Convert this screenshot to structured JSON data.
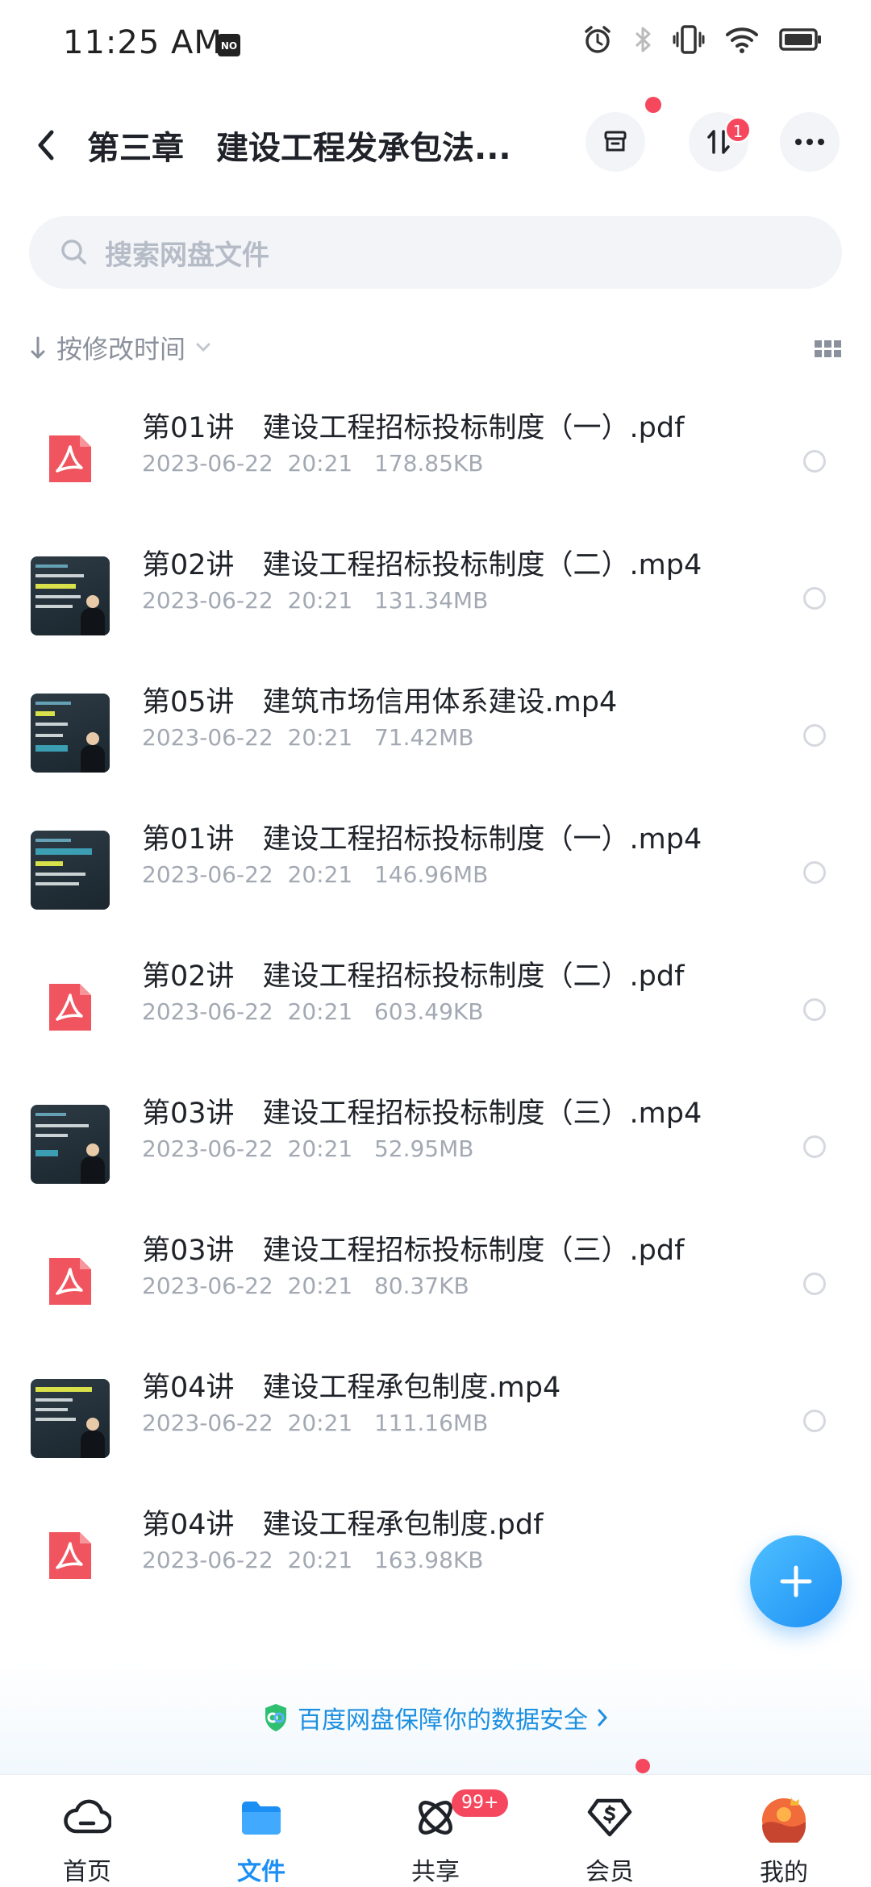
{
  "status_bar": {
    "time": "11:25 AM",
    "nfc_label": "NO"
  },
  "header": {
    "title": "第三章　建设工程发承包法...",
    "transfer_badge": "1"
  },
  "search": {
    "placeholder": "搜索网盘文件"
  },
  "sort": {
    "label": "按修改时间"
  },
  "files": [
    {
      "name": "第01讲　建设工程招标投标制度（一）.pdf",
      "date": "2023-06-22",
      "time": "20:21",
      "size": "178.85KB",
      "type": "pdf"
    },
    {
      "name": "第02讲　建设工程招标投标制度（二）.mp4",
      "date": "2023-06-22",
      "time": "20:21",
      "size": "131.34MB",
      "type": "video"
    },
    {
      "name": "第05讲　建筑市场信用体系建设.mp4",
      "date": "2023-06-22",
      "time": "20:21",
      "size": "71.42MB",
      "type": "video"
    },
    {
      "name": "第01讲　建设工程招标投标制度（一）.mp4",
      "date": "2023-06-22",
      "time": "20:21",
      "size": "146.96MB",
      "type": "video"
    },
    {
      "name": "第02讲　建设工程招标投标制度（二）.pdf",
      "date": "2023-06-22",
      "time": "20:21",
      "size": "603.49KB",
      "type": "pdf"
    },
    {
      "name": "第03讲　建设工程招标投标制度（三）.mp4",
      "date": "2023-06-22",
      "time": "20:21",
      "size": "52.95MB",
      "type": "video"
    },
    {
      "name": "第03讲　建设工程招标投标制度（三）.pdf",
      "date": "2023-06-22",
      "time": "20:21",
      "size": "80.37KB",
      "type": "pdf"
    },
    {
      "name": "第04讲　建设工程承包制度.mp4",
      "date": "2023-06-22",
      "time": "20:21",
      "size": "111.16MB",
      "type": "video"
    },
    {
      "name": "第04讲　建设工程承包制度.pdf",
      "date": "2023-06-22",
      "time": "20:21",
      "size": "163.98KB",
      "type": "pdf"
    }
  ],
  "security": {
    "text": "百度网盘保障你的数据安全"
  },
  "nav": {
    "items": [
      {
        "label": "首页",
        "icon": "cloud-home-icon",
        "active": false
      },
      {
        "label": "文件",
        "icon": "folder-icon",
        "active": true
      },
      {
        "label": "共享",
        "icon": "share-orbit-icon",
        "active": false,
        "badge": "99+"
      },
      {
        "label": "会员",
        "icon": "vip-diamond-icon",
        "active": false,
        "dot": true
      },
      {
        "label": "我的",
        "icon": "avatar-icon",
        "active": false
      }
    ]
  },
  "colors": {
    "accent": "#1c8ff5",
    "badge": "#f5485e",
    "pdf": "#f0555f",
    "muted": "#a3a9b3"
  }
}
